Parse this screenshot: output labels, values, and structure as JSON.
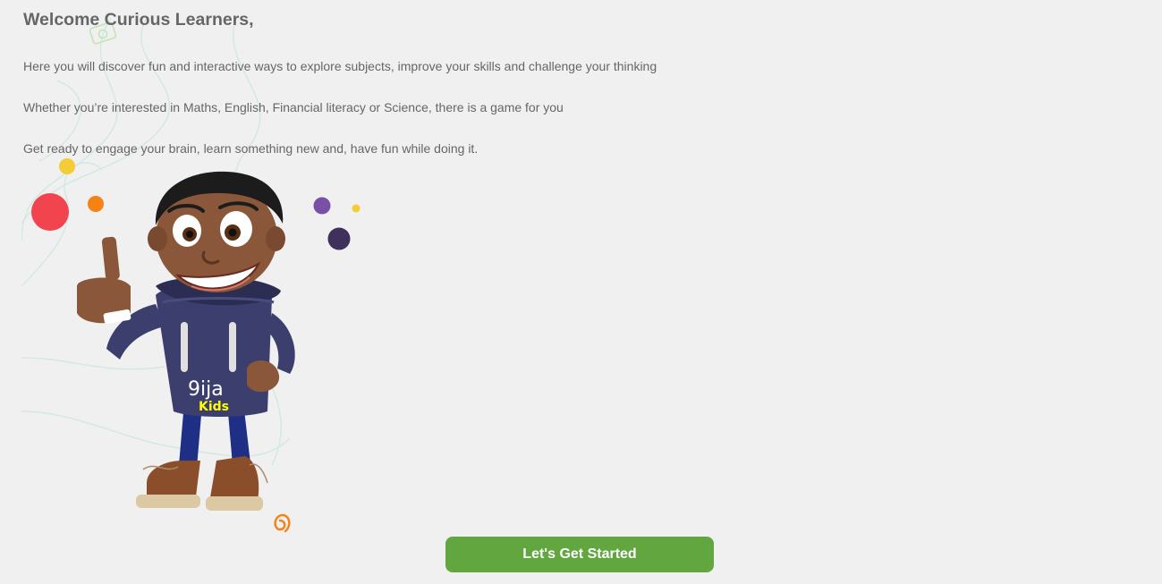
{
  "welcome": {
    "title": "Welcome Curious Learners,",
    "paragraphs": [
      "Here you will discover fun and interactive ways to explore subjects, improve your skills and challenge your thinking",
      "Whether you’re interested in Maths, English, Financial literacy or Science, there is a game for you",
      "Get ready to engage your brain, learn something new and, have fun while doing it."
    ]
  },
  "mascot": {
    "shirt_brand": "9ija",
    "shirt_sub": "Kids"
  },
  "cta": {
    "label": "Let's Get Started"
  },
  "colors": {
    "background": "#f0f0f0",
    "text": "#666666",
    "button": "#62a640",
    "button_text": "#ffffff",
    "hoodie": "#3c3e6e",
    "skin": "#8a573a"
  }
}
